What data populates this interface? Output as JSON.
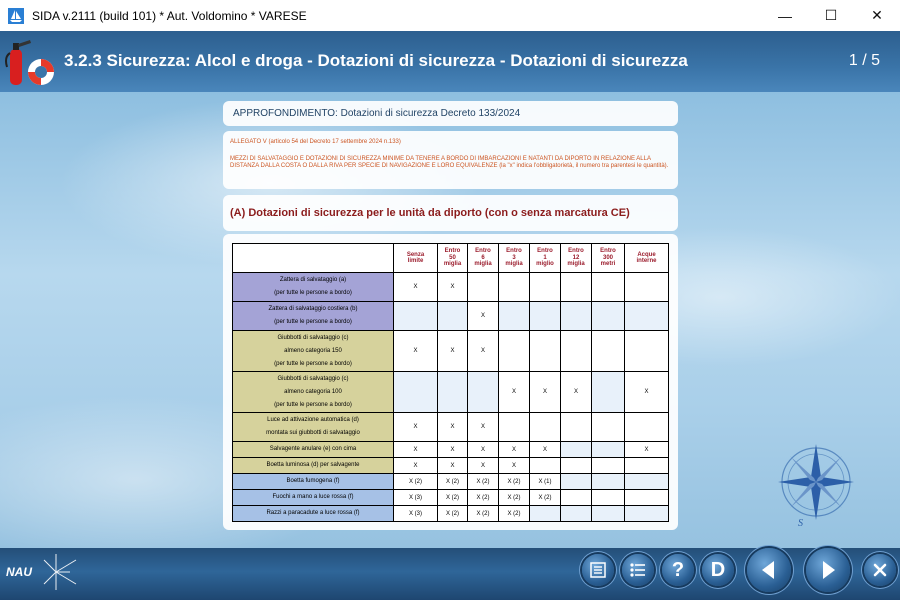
{
  "window": {
    "title": "SIDA v.2111 (build 101) * Aut. Voldomino * VARESE",
    "minimize": "—",
    "maximize": "☐",
    "close": "✕"
  },
  "header": {
    "title": "3.2.3 Sicurezza: Alcol e droga - Dotazioni di sicurezza - Dotazioni di sicurezza",
    "page": "1 / 5"
  },
  "approfondimento": "APPROFONDIMENTO: Dotazioni di sicurezza Decreto 133/2024",
  "allegato": {
    "line1": "ALLEGATO V (articolo 54 del Decreto 17 settembre 2024 n.133)",
    "line2": "MEZZI DI SALVATAGGIO E DOTAZIONI DI SICUREZZA MINIME DA TENERE A BORDO DI IMBARCAZIONI E NATANTI DA DIPORTO IN RELAZIONE ALLA DISTANZA DALLA COSTA O DALLA RIVA PER SPECIE DI NAVIGAZIONE E LORO EQUIVALENZE (la \"x\" indica l'obbligatorietà, il numero tra parentesi le quantità)."
  },
  "section_title": "(A) Dotazioni di sicurezza per le unità da diporto (con o senza marcatura CE)",
  "table": {
    "columns": [
      [
        "Senza",
        "limite"
      ],
      [
        "Entro",
        "50",
        "miglia"
      ],
      [
        "Entro",
        "6",
        "miglia"
      ],
      [
        "Entro",
        "3",
        "miglia"
      ],
      [
        "Entro",
        "1",
        "miglio"
      ],
      [
        "Entro",
        "12",
        "miglia"
      ],
      [
        "Entro",
        "300",
        "metri"
      ],
      [
        "Acque",
        "interne"
      ]
    ],
    "rows": [
      {
        "label": [
          "Zattera di salvataggio (a)",
          "(per tutte le persone a bordo)"
        ],
        "color": "purple",
        "cells": [
          "X",
          "X",
          "",
          "",
          "",
          "",
          "",
          ""
        ]
      },
      {
        "label": [
          "Zattera di salvataggio costiera (b)",
          "(per tutte le persone a bordo)"
        ],
        "color": "purple",
        "cells": [
          "",
          "",
          "X",
          "",
          "",
          "",
          "",
          ""
        ]
      },
      {
        "label": [
          "Giubbotti di salvataggio (c)",
          "almeno categoria 150",
          "(per tutte le persone a bordo)"
        ],
        "color": "khaki",
        "cells": [
          "X",
          "X",
          "X",
          "",
          "",
          "",
          "",
          ""
        ]
      },
      {
        "label": [
          "Giubbotti di salvataggio (c)",
          "almeno categoria 100",
          "(per tutte le persone a bordo)"
        ],
        "color": "khaki",
        "cells": [
          "",
          "",
          "",
          "X",
          "X",
          "X",
          "",
          "X"
        ]
      },
      {
        "label": [
          "Luce ad attivazione automatica (d)",
          "montata sui giubbotti di salvataggio"
        ],
        "color": "khaki",
        "cells": [
          "X",
          "X",
          "X",
          "",
          "",
          "",
          "",
          ""
        ]
      },
      {
        "label": [
          "Salvagente anulare (e) con cima"
        ],
        "color": "khaki",
        "cells": [
          "X",
          "X",
          "X",
          "X",
          "X",
          "",
          "",
          "X"
        ]
      },
      {
        "label": [
          "Boetta luminosa (d) per salvagente"
        ],
        "color": "khaki",
        "cells": [
          "X",
          "X",
          "X",
          "X",
          "",
          "",
          "",
          ""
        ]
      },
      {
        "label": [
          "Boetta fumogena (f)"
        ],
        "color": "blue",
        "cells": [
          "X (2)",
          "X (2)",
          "X (2)",
          "X (2)",
          "X (1)",
          "",
          "",
          ""
        ]
      },
      {
        "label": [
          "Fuochi a mano a luce rossa (f)"
        ],
        "color": "blue",
        "cells": [
          "X (3)",
          "X (2)",
          "X (2)",
          "X (2)",
          "X (2)",
          "",
          "",
          ""
        ]
      },
      {
        "label": [
          "Razzi a paracadute a luce rossa (f)"
        ],
        "color": "blue",
        "cells": [
          "X (3)",
          "X (2)",
          "X (2)",
          "X (2)",
          "",
          "",
          "",
          ""
        ]
      }
    ]
  },
  "logo_text": "NAU",
  "nav": {
    "d_label": "D",
    "help_label": "?"
  },
  "colors": {
    "header": "#3a74a8",
    "bottombar": "#2f6699",
    "purple": "#a4a3d6",
    "khaki": "#d6d29c",
    "blue": "#a6c1e6",
    "header_text": "#9b1c2c"
  },
  "icons": [
    "app-sailboat-icon",
    "fire-extinguisher-icon",
    "life-ring-icon",
    "compass-rose-icon",
    "list-doc-icon",
    "list-bullets-icon",
    "question-icon",
    "d-icon",
    "arrow-left-icon",
    "arrow-right-icon",
    "close-icon"
  ]
}
